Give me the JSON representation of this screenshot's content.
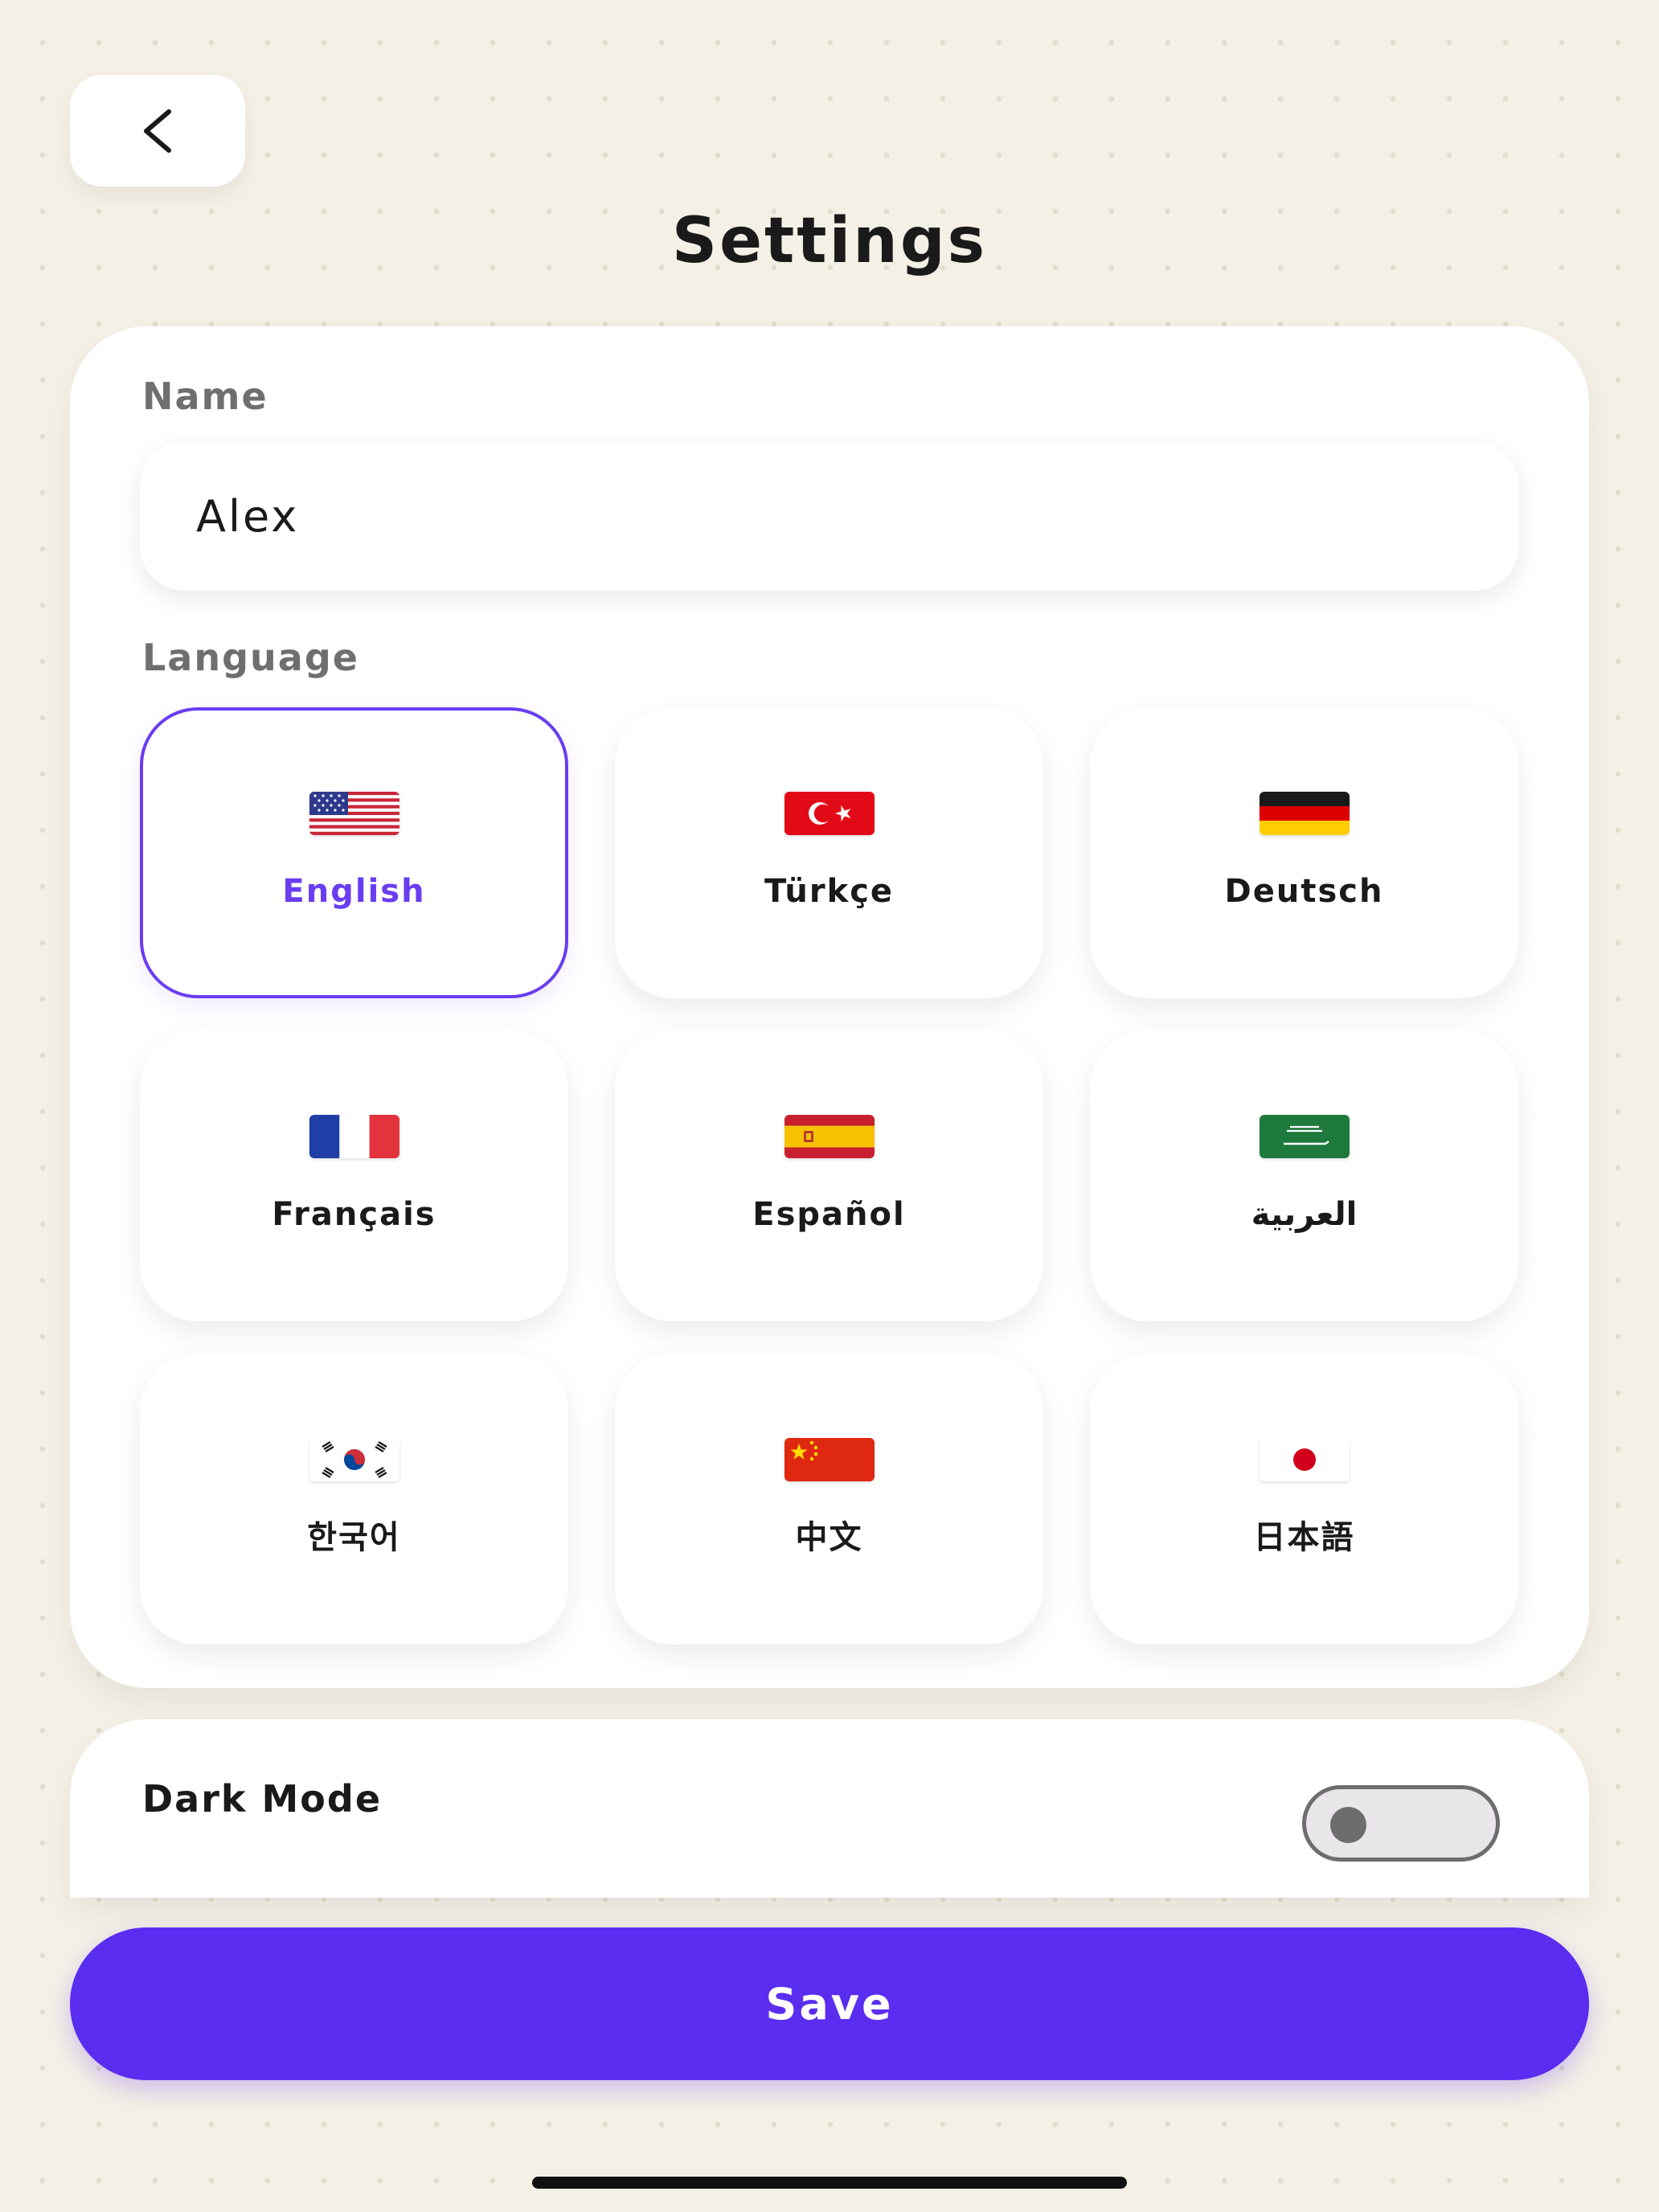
{
  "header": {
    "title": "Settings",
    "back_icon": "chevron-left-icon"
  },
  "form": {
    "name_label": "Name",
    "name_value": "Alex",
    "language_label": "Language",
    "selected_language": "English",
    "languages": [
      {
        "label": "English",
        "flag": "us-flag-icon",
        "selected": true
      },
      {
        "label": "Türkçe",
        "flag": "turkey-flag-icon",
        "selected": false
      },
      {
        "label": "Deutsch",
        "flag": "germany-flag-icon",
        "selected": false
      },
      {
        "label": "Français",
        "flag": "france-flag-icon",
        "selected": false
      },
      {
        "label": "Español",
        "flag": "spain-flag-icon",
        "selected": false
      },
      {
        "label": "العربية",
        "flag": "saudi-flag-icon",
        "selected": false
      },
      {
        "label": "한국어",
        "flag": "korea-flag-icon",
        "selected": false
      },
      {
        "label": "中文",
        "flag": "china-flag-icon",
        "selected": false
      },
      {
        "label": "日本語",
        "flag": "japan-flag-icon",
        "selected": false
      }
    ]
  },
  "dark_mode": {
    "label": "Dark Mode",
    "enabled": false
  },
  "footer": {
    "save_label": "Save"
  },
  "colors": {
    "background": "#f4f0e6",
    "accent": "#6a3df0",
    "save_button": "#5b2df0",
    "toggle_off": "#6d6d6d"
  }
}
